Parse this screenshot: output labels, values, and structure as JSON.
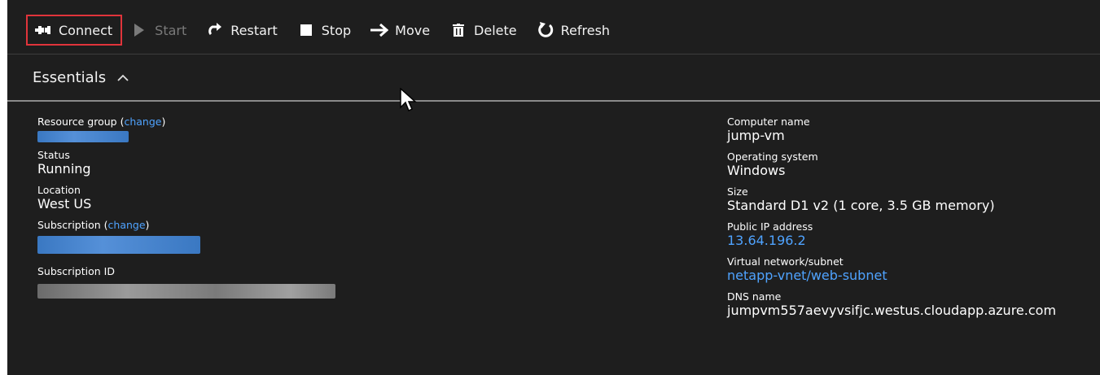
{
  "toolbar": {
    "connect": "Connect",
    "start": "Start",
    "restart": "Restart",
    "stop": "Stop",
    "move": "Move",
    "delete": "Delete",
    "refresh": "Refresh"
  },
  "essentials": {
    "title": "Essentials"
  },
  "left": {
    "resource_group_label": "Resource group",
    "change_text": "change",
    "status_label": "Status",
    "status_value": "Running",
    "location_label": "Location",
    "location_value": "West US",
    "subscription_label": "Subscription",
    "subscription_id_label": "Subscription ID"
  },
  "right": {
    "computer_name_label": "Computer name",
    "computer_name_value": "jump-vm",
    "os_label": "Operating system",
    "os_value": "Windows",
    "size_label": "Size",
    "size_value": "Standard D1 v2 (1 core, 3.5 GB memory)",
    "public_ip_label": "Public IP address",
    "public_ip_value": "13.64.196.2",
    "vnet_label": "Virtual network/subnet",
    "vnet_value": "netapp-vnet/web-subnet",
    "dns_label": "DNS name",
    "dns_value": "jumpvm557aevyvsifjc.westus.cloudapp.azure.com"
  },
  "colors": {
    "background": "#1e1e1e",
    "link": "#4fa3ff",
    "highlight_border": "#e0343b"
  }
}
